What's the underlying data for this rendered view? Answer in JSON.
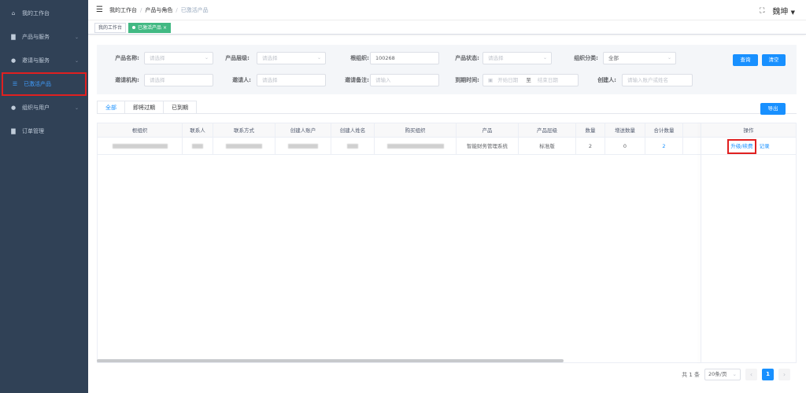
{
  "sidebar": {
    "items": [
      {
        "icon": "home-icon",
        "label": "我的工作台",
        "chevron": false,
        "active": false
      },
      {
        "icon": "folder-icon",
        "label": "产品与服务",
        "chevron": true,
        "active": false
      },
      {
        "icon": "user-icon",
        "label": "邀请与服务",
        "chevron": true,
        "active": false
      },
      {
        "icon": "list-icon",
        "label": "已激活产品",
        "chevron": false,
        "active": true
      },
      {
        "icon": "user-icon",
        "label": "组织与用户",
        "chevron": true,
        "active": false
      },
      {
        "icon": "folder-icon",
        "label": "订单管理",
        "chevron": false,
        "active": false
      }
    ]
  },
  "header": {
    "breadcrumb": [
      "我的工作台",
      "产品与角色",
      "已激活产品"
    ],
    "user_name": "魏坤"
  },
  "tags": [
    {
      "label": "我的工作台",
      "active": false
    },
    {
      "label": "已激活产品",
      "active": true,
      "close": "×"
    }
  ],
  "filters": {
    "product_name": {
      "label": "产品名称:",
      "placeholder": "请选择"
    },
    "product_level": {
      "label": "产品层级:",
      "placeholder": "请选择"
    },
    "root_org": {
      "label": "根组织:",
      "value": "100268"
    },
    "product_status": {
      "label": "产品状态:",
      "placeholder": "请选择"
    },
    "org_category": {
      "label": "组织分类:",
      "value": "全部"
    },
    "invite_org": {
      "label": "邀请机构:",
      "placeholder": "请选择"
    },
    "inviter": {
      "label": "邀请人:",
      "placeholder": "请选择"
    },
    "invite_note": {
      "label": "邀请备注:",
      "placeholder": "请输入"
    },
    "expire_time": {
      "label": "到期时间:",
      "start_placeholder": "开始日期",
      "end_placeholder": "结束日期",
      "separator": "至"
    },
    "creator": {
      "label": "创建人:",
      "placeholder": "请输入账户或姓名"
    },
    "query_button": "查询",
    "clear_button": "清空"
  },
  "tabs": [
    "全部",
    "即将过期",
    "已到期"
  ],
  "export_button": "导出",
  "table": {
    "columns": [
      "根组织",
      "联系人",
      "联系方式",
      "创建人账户",
      "创建人姓名",
      "购买组织",
      "产品",
      "产品层级",
      "数量",
      "增送数量",
      "合计数量",
      "操作"
    ],
    "rows": [
      {
        "product": "智能财务管理系统",
        "level": "标准版",
        "qty": "2",
        "gift": "0",
        "total": "2",
        "op_upgrade": "升级/续费",
        "op_record": "记录"
      }
    ]
  },
  "pagination": {
    "total": "共 1 条",
    "page_size": "20条/页",
    "current": "1",
    "prev": "‹",
    "next": "›"
  }
}
